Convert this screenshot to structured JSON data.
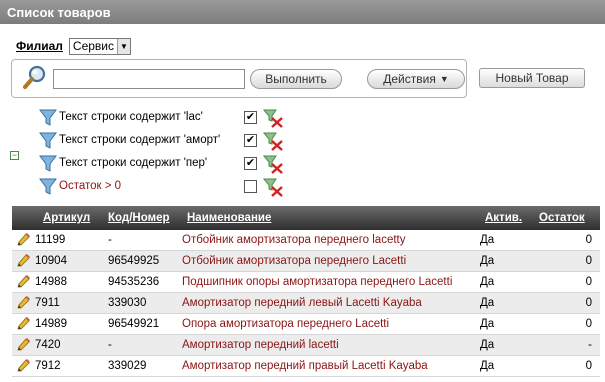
{
  "window": {
    "title": "Список товаров"
  },
  "branch": {
    "label": "Филиал",
    "selected": "Сервис"
  },
  "search": {
    "value": "",
    "run_label": "Выполнить",
    "actions_label": "Действия"
  },
  "toolbar": {
    "new_item_label": "Новый Товар"
  },
  "filters": [
    {
      "text": "Текст строки содержит 'lac'",
      "checked": true
    },
    {
      "text": "Текст строки содержит 'аморт'",
      "checked": true
    },
    {
      "text": "Текст строки содержит 'пер'",
      "checked": true
    },
    {
      "text": "Остаток > 0",
      "checked": false
    }
  ],
  "table": {
    "headers": {
      "article": "Артикул",
      "code": "Код/Номер",
      "name": "Наименование",
      "active": "Актив.",
      "rest": "Остаток"
    },
    "rows": [
      {
        "article": "11199",
        "code": "-",
        "name": "Отбойник амортизатора переднего lacetty",
        "active": "Да",
        "rest": "0"
      },
      {
        "article": "10904",
        "code": "96549925",
        "name": "Отбойник амортизатора переднего Lacetti",
        "active": "Да",
        "rest": "0"
      },
      {
        "article": "14988",
        "code": "94535236",
        "name": "Подшипник опоры амортизатора переднего Lacetti",
        "active": "Да",
        "rest": "0"
      },
      {
        "article": "7911",
        "code": "339030",
        "name": "Амортизатор передний левый Lacetti Kayaba",
        "active": "Да",
        "rest": "0"
      },
      {
        "article": "14989",
        "code": "96549921",
        "name": "Опора амортизатора переднего Lacetti",
        "active": "Да",
        "rest": "0"
      },
      {
        "article": "7420",
        "code": "-",
        "name": "Амортизатор передний lacetti",
        "active": "Да",
        "rest": "-"
      },
      {
        "article": "7912",
        "code": "339029",
        "name": "Амортизатор передний правый Lacetti Kayaba",
        "active": "Да",
        "rest": "0"
      }
    ]
  },
  "icons": {
    "search": "magnifier-icon",
    "filter": "funnel-icon",
    "remove_filter": "remove-filter-icon",
    "edit": "pencil-icon",
    "collapse": "collapse-icon"
  }
}
